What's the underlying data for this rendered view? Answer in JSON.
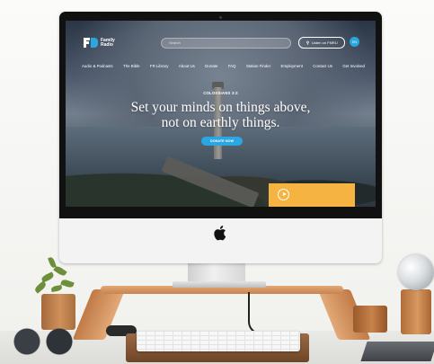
{
  "site": {
    "logo_text": "Family Radio",
    "search_placeholder": "Search",
    "listen_label": "Listen on FMRL!",
    "language_label": "EN"
  },
  "nav": {
    "items": [
      "Audio & Podcasts",
      "The Bible",
      "FR Library",
      "About Us",
      "Donate",
      "FAQ",
      "Station Finder",
      "Employment",
      "Contact Us",
      "Get Involved"
    ]
  },
  "hero": {
    "reference": "COLOSSIANS 3:2",
    "line1": "Set your minds on things above,",
    "line2": "not on earthly things.",
    "donate_label": "DONATE NOW"
  },
  "colors": {
    "brand_blue": "#2aa6e0",
    "player_orange": "#f5b342",
    "wood": "#d69a63"
  },
  "icons": {
    "apple": "apple-icon",
    "play": "play-icon",
    "listen": "radio-icon"
  }
}
